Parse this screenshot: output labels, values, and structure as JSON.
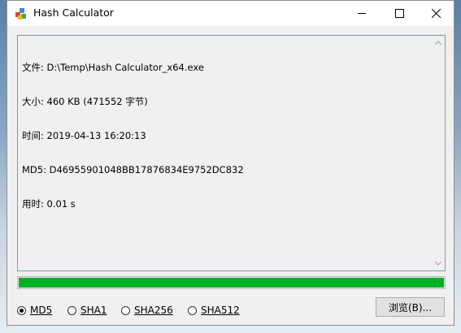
{
  "window": {
    "title": "Hash Calculator",
    "controls": {
      "minimize": "minimize-icon",
      "maximize": "maximize-icon",
      "close": "close-icon"
    }
  },
  "output": {
    "lines": [
      "文件: D:\\Temp\\Hash Calculator_x64.exe",
      "大小: 460 KB (471552 字节)",
      "时间: 2019-04-13 16:20:13",
      "MD5: D46955901048BB17876834E9752DC832",
      "用时: 0.01 s"
    ]
  },
  "progress": {
    "value_percent": 100,
    "color": "#06b025"
  },
  "options": {
    "algorithms": [
      {
        "label": "MD5",
        "checked": true
      },
      {
        "label": "SHA1",
        "checked": false
      },
      {
        "label": "SHA256",
        "checked": false
      },
      {
        "label": "SHA512",
        "checked": false
      }
    ]
  },
  "buttons": {
    "browse": "浏览(B)..."
  }
}
